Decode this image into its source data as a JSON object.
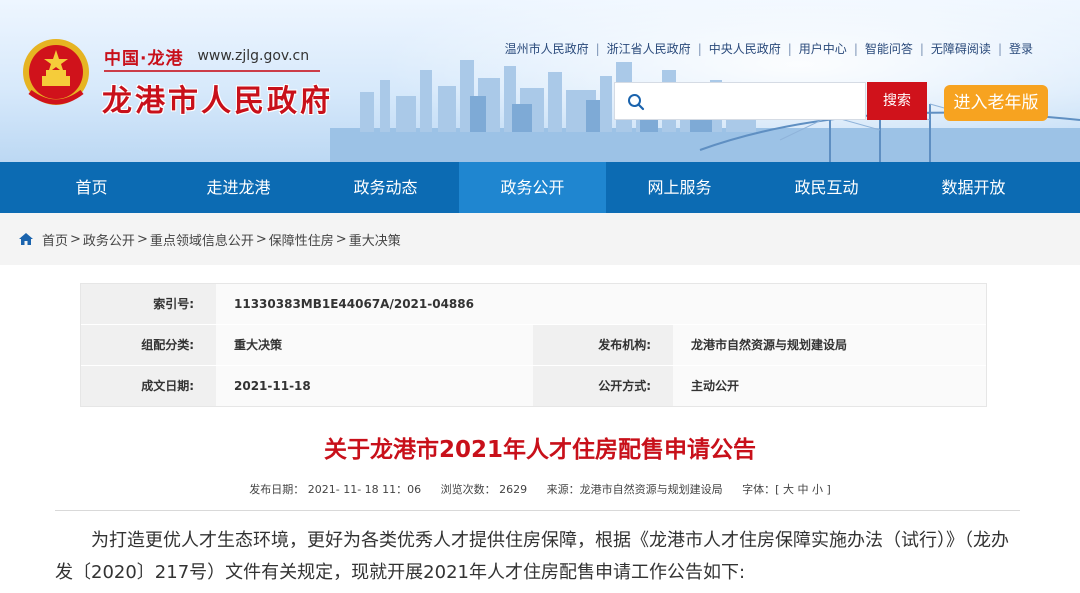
{
  "header": {
    "brand_cn": "中国·龙港",
    "brand_url": "www.zjlg.gov.cn",
    "site_title": "龙港市人民政府",
    "toplinks": [
      "温州市人民政府",
      "浙江省人民政府",
      "中央人民政府",
      "用户中心",
      "智能问答",
      "无障碍阅读",
      "登录"
    ],
    "search_placeholder": "",
    "search_button": "搜索",
    "elder_button": "进入老年版"
  },
  "nav": {
    "items": [
      "首页",
      "走进龙港",
      "政务动态",
      "政务公开",
      "网上服务",
      "政民互动",
      "数据开放"
    ],
    "active": "政务公开"
  },
  "breadcrumb": [
    "首页",
    "政务公开",
    "重点领域信息公开",
    "保障性住房",
    "重大决策"
  ],
  "info": {
    "index_label": "索引号:",
    "index_value": "11330383MB1E44067A/2021-04886",
    "category_label": "组配分类:",
    "category_value": "重大决策",
    "publisher_label": "发布机构:",
    "publisher_value": "龙港市自然资源与规划建设局",
    "date_label": "成文日期:",
    "date_value": "2021-11-18",
    "method_label": "公开方式:",
    "method_value": "主动公开"
  },
  "article": {
    "title": "关于龙港市2021年人才住房配售申请公告",
    "meta_date": "发布日期：  2021- 11- 18 11：06",
    "meta_views": "浏览次数：  2629",
    "meta_source": "来源：龙港市自然资源与规划建设局",
    "meta_font": "字体：[ 大 中 小 ]",
    "paragraph": "为打造更优人才生态环境，更好为各类优秀人才提供住房保障，根据《龙港市人才住房保障实施办法（试行）》（龙办发〔2020〕217号）文件有关规定，现就开展2021年人才住房配售申请工作公告如下:"
  },
  "colors": {
    "brand_red": "#c8101a",
    "nav_blue": "#0c6bb3",
    "nav_active": "#1f86d0",
    "elder_orange": "#f7a320"
  }
}
